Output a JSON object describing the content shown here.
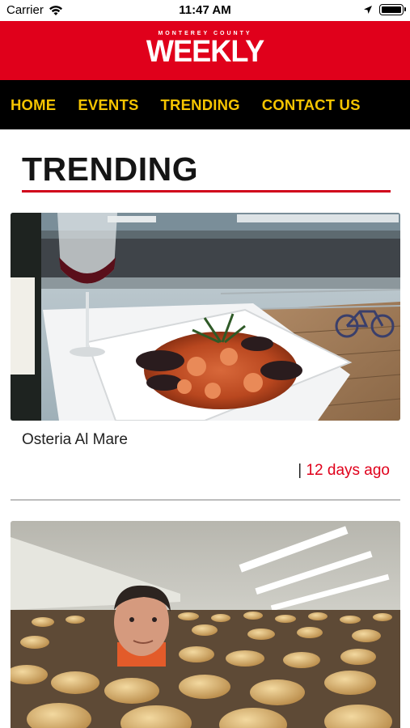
{
  "status_bar": {
    "carrier": "Carrier",
    "time": "11:47 AM"
  },
  "header": {
    "logo_top": "MONTEREY COUNTY",
    "logo_main": "WEEKLY",
    "brand_color": "#e0001b"
  },
  "nav": {
    "items": [
      {
        "label": "HOME"
      },
      {
        "label": "EVENTS"
      },
      {
        "label": "TRENDING"
      },
      {
        "label": "CONTACT US"
      }
    ],
    "accent": "#f5c400"
  },
  "section": {
    "title": "TRENDING"
  },
  "articles": [
    {
      "title": "Osteria Al Mare",
      "separator": "|",
      "time_ago": "12 days ago",
      "image": "seafood-pasta-dish-with-wine-photo"
    },
    {
      "image": "man-in-mushroom-farm-photo"
    }
  ]
}
